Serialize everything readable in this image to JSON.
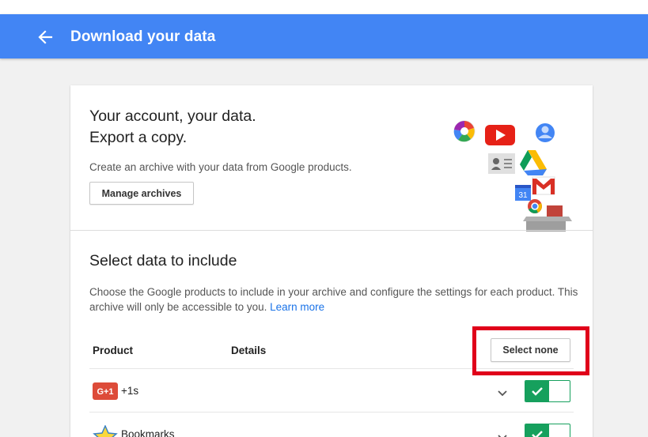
{
  "appbar": {
    "title": "Download your data",
    "back_icon": "arrow-left-icon",
    "color": "#4285f4"
  },
  "hero": {
    "heading_line1": "Your account, your data.",
    "heading_line2": "Export a copy.",
    "description": "Create an archive with your data from Google products.",
    "manage_button": "Manage archives",
    "calendar_day": "31"
  },
  "select": {
    "heading": "Select data to include",
    "description": "Choose the Google products to include in your archive and configure the settings for each product. This archive will only be accessible to you.",
    "learn_more": "Learn more",
    "select_none_button": "Select none"
  },
  "table": {
    "columns": {
      "product": "Product",
      "details": "Details"
    },
    "rows": [
      {
        "label": "+1s",
        "icon": "google-plus-one-icon",
        "icon_text": "G+1",
        "enabled": true
      },
      {
        "label": "Bookmarks",
        "icon": "star-bookmark-icon",
        "enabled": true
      }
    ]
  },
  "colors": {
    "toggle_on": "#16a05d",
    "highlight": "#e0001a",
    "link": "#1a73e8"
  }
}
